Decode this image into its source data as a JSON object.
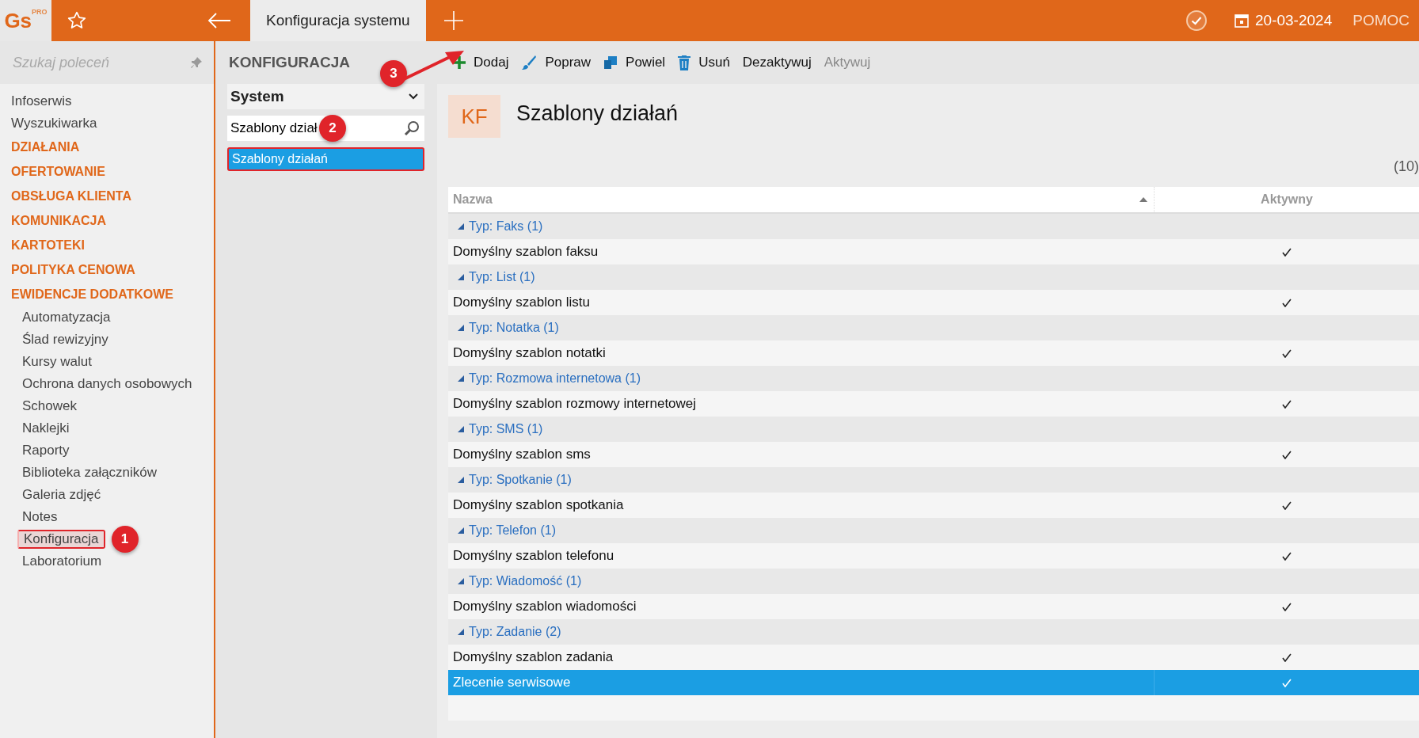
{
  "topbar": {
    "logo": "Gs",
    "logo_sup": "PRO",
    "tab": {
      "label": "Konfiguracja systemu",
      "selected": true
    },
    "date": "20-03-2024",
    "help": "POMOC"
  },
  "sidebar": {
    "search": {
      "placeholder": "Szukaj poleceń"
    },
    "items": [
      {
        "label": "Infoserwis",
        "kind": "link",
        "selected": false
      },
      {
        "label": "Wyszukiwarka",
        "kind": "link",
        "selected": false
      },
      {
        "label": "DZIAŁANIA",
        "kind": "section",
        "selected": false
      },
      {
        "label": "OFERTOWANIE",
        "kind": "section",
        "selected": false
      },
      {
        "label": "OBSŁUGA KLIENTA",
        "kind": "section",
        "selected": false
      },
      {
        "label": "KOMUNIKACJA",
        "kind": "section",
        "selected": false
      },
      {
        "label": "KARTOTEKI",
        "kind": "section",
        "selected": false
      },
      {
        "label": "POLITYKA CENOWA",
        "kind": "section",
        "selected": false
      },
      {
        "label": "EWIDENCJE DODATKOWE",
        "kind": "section",
        "selected": false
      },
      {
        "label": "Automatyzacja",
        "kind": "sub",
        "selected": false
      },
      {
        "label": "Ślad rewizyjny",
        "kind": "sub",
        "selected": false
      },
      {
        "label": "Kursy walut",
        "kind": "sub",
        "selected": false
      },
      {
        "label": "Ochrona danych osobowych",
        "kind": "sub",
        "selected": false
      },
      {
        "label": "Schowek",
        "kind": "sub",
        "selected": false
      },
      {
        "label": "Naklejki",
        "kind": "sub",
        "selected": false
      },
      {
        "label": "Raporty",
        "kind": "sub",
        "selected": false
      },
      {
        "label": "Biblioteka załączników",
        "kind": "sub",
        "selected": false
      },
      {
        "label": "Galeria zdjęć",
        "kind": "sub",
        "selected": false
      },
      {
        "label": "Notes",
        "kind": "sub",
        "selected": false
      },
      {
        "label": "Konfiguracja",
        "kind": "sub",
        "selected": true,
        "callout": "1"
      },
      {
        "label": "Laboratorium",
        "kind": "sub",
        "selected": false
      }
    ]
  },
  "config_panel": {
    "title": "KONFIGURACJA",
    "dropdown": "System",
    "search": {
      "value": "Szablony dział",
      "callout": "2"
    },
    "results": [
      {
        "label": "Szablony działań",
        "selected": true
      }
    ]
  },
  "toolbar": {
    "callout": "3",
    "buttons": [
      {
        "label": "Dodaj",
        "kind": "add",
        "disabled": false
      },
      {
        "label": "Popraw",
        "kind": "edit",
        "disabled": false
      },
      {
        "label": "Powiel",
        "kind": "duplicate",
        "disabled": false
      },
      {
        "label": "Usuń",
        "kind": "delete",
        "disabled": false
      },
      {
        "label": "Dezaktywuj",
        "kind": "text",
        "disabled": false
      },
      {
        "label": "Aktywuj",
        "kind": "text",
        "disabled": true
      }
    ]
  },
  "header": {
    "badge": "KF",
    "title": "Szablony działań",
    "count": "(10)"
  },
  "table": {
    "columns": [
      "Nazwa",
      "Aktywny"
    ],
    "rows": [
      {
        "kind": "group",
        "label": "Typ: Faks (1)",
        "expanded": true
      },
      {
        "kind": "row",
        "name": "Domyślny szablon faksu",
        "active": true,
        "selected": false
      },
      {
        "kind": "group",
        "label": "Typ: List (1)",
        "expanded": true
      },
      {
        "kind": "row",
        "name": "Domyślny szablon listu",
        "active": true,
        "selected": false
      },
      {
        "kind": "group",
        "label": "Typ: Notatka (1)",
        "expanded": true
      },
      {
        "kind": "row",
        "name": "Domyślny szablon notatki",
        "active": true,
        "selected": false
      },
      {
        "kind": "group",
        "label": "Typ: Rozmowa internetowa (1)",
        "expanded": true
      },
      {
        "kind": "row",
        "name": "Domyślny szablon rozmowy internetowej",
        "active": true,
        "selected": false
      },
      {
        "kind": "group",
        "label": "Typ: SMS (1)",
        "expanded": true
      },
      {
        "kind": "row",
        "name": "Domyślny szablon sms",
        "active": true,
        "selected": false
      },
      {
        "kind": "group",
        "label": "Typ: Spotkanie (1)",
        "expanded": true
      },
      {
        "kind": "row",
        "name": "Domyślny szablon spotkania",
        "active": true,
        "selected": false
      },
      {
        "kind": "group",
        "label": "Typ: Telefon (1)",
        "expanded": true
      },
      {
        "kind": "row",
        "name": "Domyślny szablon telefonu",
        "active": true,
        "selected": false
      },
      {
        "kind": "group",
        "label": "Typ: Wiadomość (1)",
        "expanded": true
      },
      {
        "kind": "row",
        "name": "Domyślny szablon wiadomości",
        "active": true,
        "selected": false
      },
      {
        "kind": "group",
        "label": "Typ: Zadanie (2)",
        "expanded": true
      },
      {
        "kind": "row",
        "name": "Domyślny szablon zadania",
        "active": true,
        "selected": false
      },
      {
        "kind": "row",
        "name": "Zlecenie serwisowe",
        "active": true,
        "selected": true
      }
    ]
  }
}
